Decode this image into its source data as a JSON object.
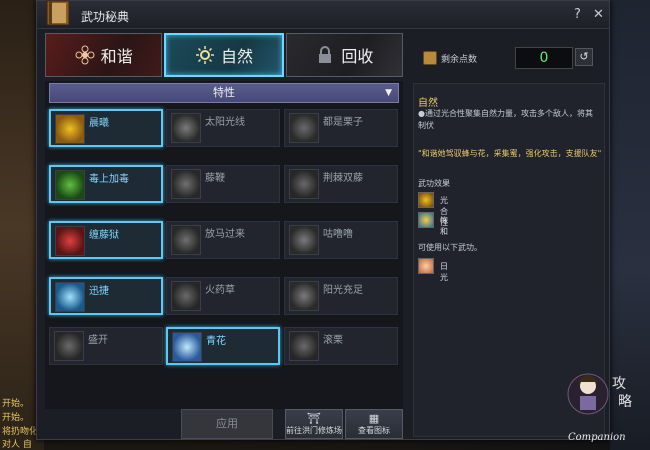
{
  "window": {
    "title": "武功秘典",
    "help": "?",
    "close": "✕"
  },
  "tabs": [
    {
      "label": "和谐",
      "active": false
    },
    {
      "label": "自然",
      "active": true
    },
    {
      "label": "回收",
      "active": false
    }
  ],
  "points": {
    "label": "剩余点数",
    "value": "0"
  },
  "dropdown": {
    "label": "特性"
  },
  "skills": [
    {
      "label": "晨曦",
      "active": true
    },
    {
      "label": "太阳光线",
      "active": false
    },
    {
      "label": "都是栗子",
      "active": false
    },
    {
      "label": "毒上加毒",
      "active": true
    },
    {
      "label": "藤鞭",
      "active": false
    },
    {
      "label": "荆棘双藤",
      "active": false
    },
    {
      "label": "缠藤狱",
      "active": true
    },
    {
      "label": "放马过来",
      "active": false
    },
    {
      "label": "咕噜噜",
      "active": false
    },
    {
      "label": "迅捷",
      "active": true
    },
    {
      "label": "火药草",
      "active": false
    },
    {
      "label": "阳光充足",
      "active": false
    },
    {
      "label": "盛开",
      "active": false
    },
    {
      "label": "青花",
      "active": true
    },
    {
      "label": "滚栗",
      "active": false
    }
  ],
  "buttons": {
    "apply": "应用",
    "training": "前往洪门修炼场",
    "view_icons": "查看图标"
  },
  "info": {
    "title": "自然",
    "desc": "●通过光合性聚集自然力量，攻击多个敌人，将其制伏",
    "quote": "\"和谐她驾驭蜂与花，采集蜜，强化攻击，支援队友\"",
    "effects_title": "武功效果",
    "effects": [
      "光合性",
      "饱和"
    ],
    "usable_title": "可使用以下武功。",
    "usable": [
      "日光"
    ]
  },
  "background": {
    "lines": [
      "开始。",
      "开始。",
      "将扔吻化。",
      "对人 自"
    ]
  },
  "watermark": {
    "text": "Companion"
  }
}
